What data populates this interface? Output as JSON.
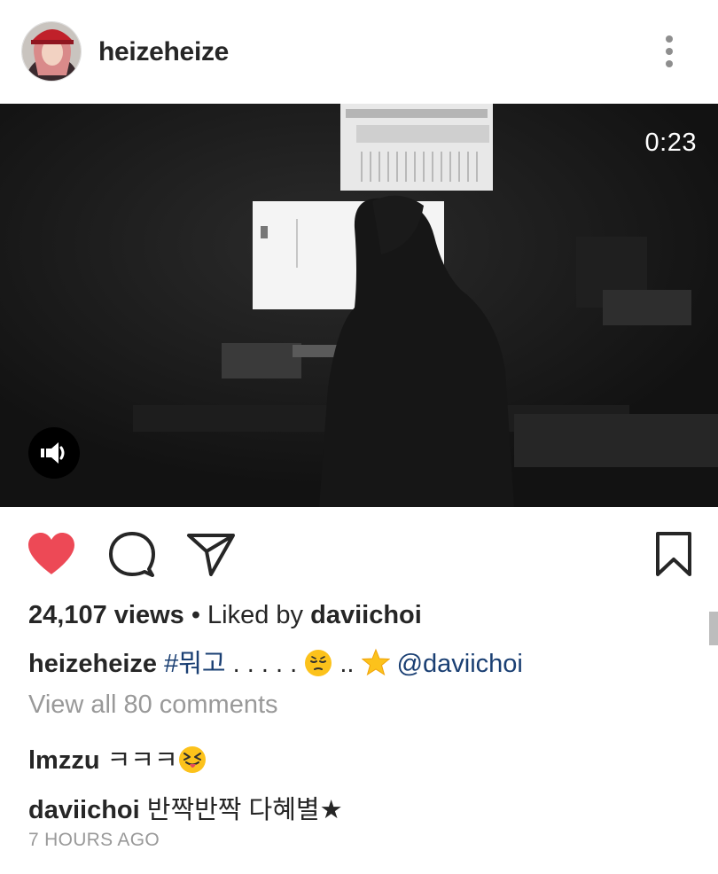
{
  "header": {
    "username": "heizeheize",
    "avatar_icon": "avatar-photo",
    "menu_icon": "more-vertical-icon"
  },
  "video": {
    "duration": "0:23",
    "sound_icon": "speaker-icon"
  },
  "actions": {
    "like_icon": "heart-icon",
    "like_color": "#ed4956",
    "comment_icon": "comment-icon",
    "share_icon": "send-icon",
    "save_icon": "bookmark-icon"
  },
  "stats": {
    "views": "24,107 views",
    "separator": " • Liked by ",
    "liked_by": "daviichoi"
  },
  "caption": {
    "author": "heizeheize",
    "hashtag": "#뭐고",
    "dots1": " . . . . . ",
    "dots2": " .. ",
    "mention": "@daviichoi",
    "mention_color": "#1a3f73"
  },
  "comments": {
    "view_all": "View all 80 comments",
    "items": [
      {
        "author": "lmzzu",
        "text": "ㅋㅋㅋ"
      },
      {
        "author": "daviichoi",
        "text": "반짝반짝 다혜별★"
      }
    ]
  },
  "timestamp": "7 HOURS AGO"
}
